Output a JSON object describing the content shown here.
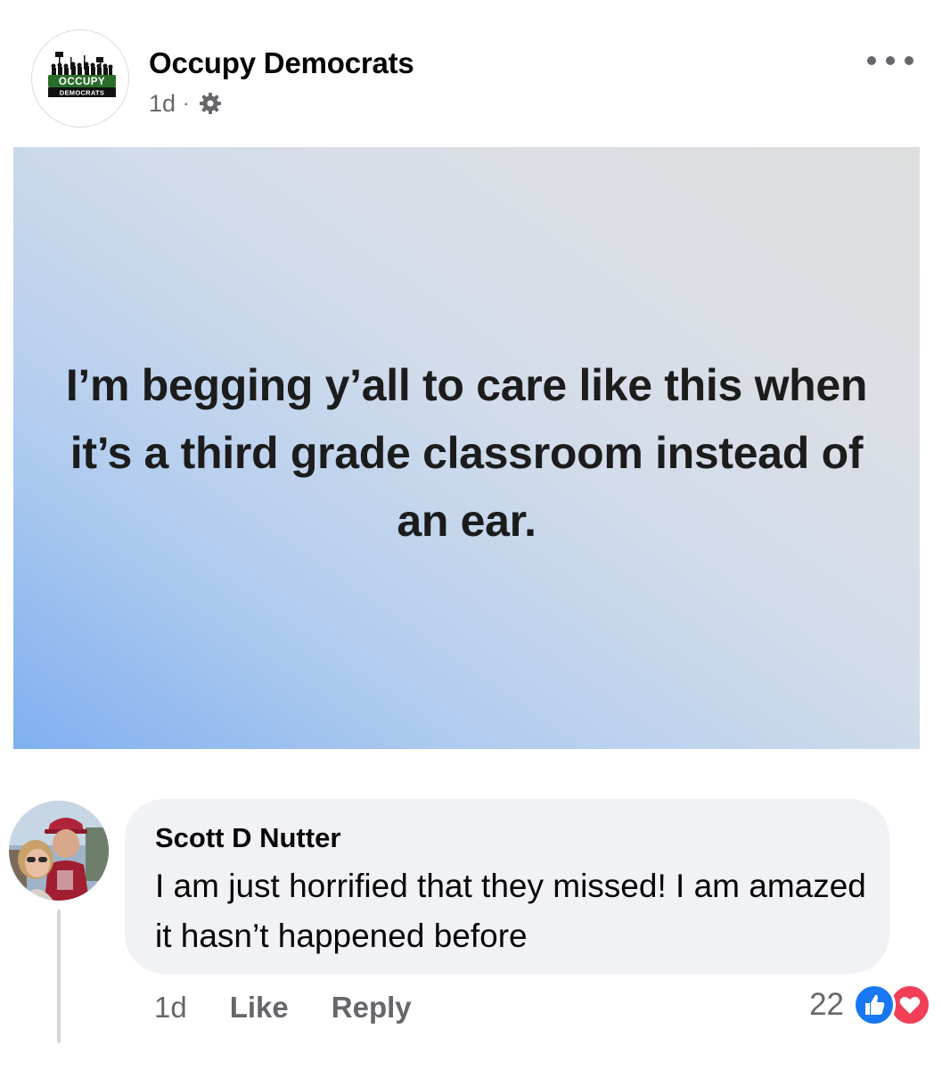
{
  "post": {
    "author": "Occupy Democrats",
    "time": "1d",
    "separator": "·",
    "privacy_icon": "gear-icon",
    "more_icon": "more-horizontal-icon",
    "avatar_logo_line1": "OCCUPY",
    "avatar_logo_line2": "DEMOCRATS",
    "text": "I’m begging y’all to care like this when it’s a third grade classroom instead of an ear.",
    "background_colors": [
      "#7fb0ef",
      "#dddede"
    ]
  },
  "comment": {
    "author": "Scott D Nutter",
    "text": "I am just horrified that they missed!  I am amazed it hasn’t happened before",
    "time": "1d",
    "like_label": "Like",
    "reply_label": "Reply",
    "reaction_count": "22",
    "reaction_icons": [
      "like-reaction-icon",
      "love-reaction-icon"
    ],
    "colors": {
      "like": "#1877f2",
      "love": "#f33e58",
      "bubble": "#f0f2f5"
    }
  }
}
